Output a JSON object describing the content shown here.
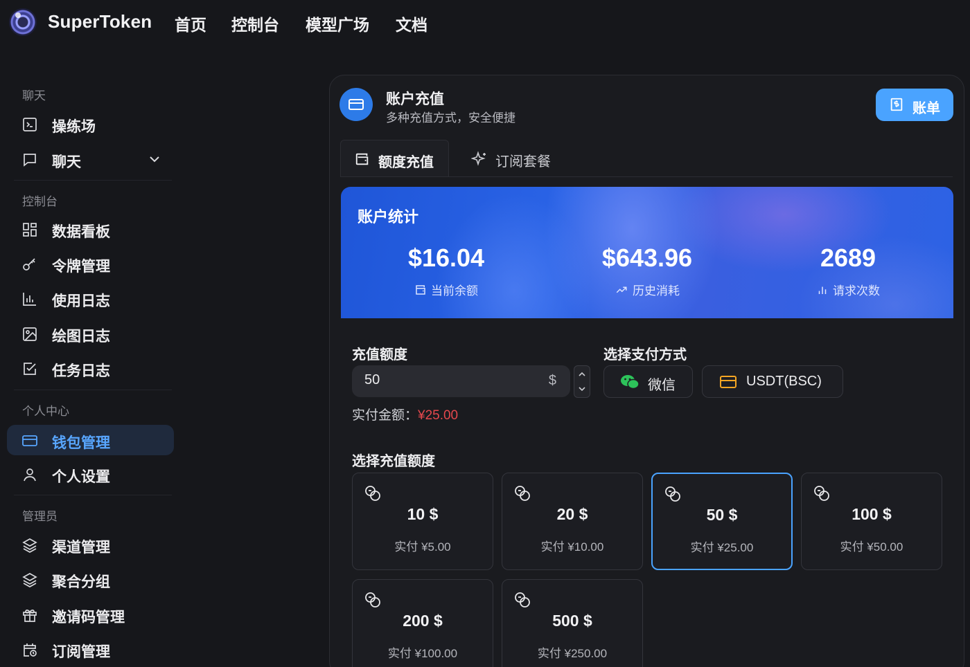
{
  "brand": "SuperToken",
  "nav": [
    "首页",
    "控制台",
    "模型广场",
    "文档"
  ],
  "sidebar": {
    "sections": [
      {
        "title": "聊天",
        "items": [
          {
            "label": "操练场",
            "icon": "terminal-icon"
          },
          {
            "label": "聊天",
            "icon": "chat-icon"
          }
        ]
      },
      {
        "title": "控制台",
        "items": [
          {
            "label": "数据看板",
            "icon": "dashboard-icon"
          },
          {
            "label": "令牌管理",
            "icon": "key-icon"
          },
          {
            "label": "使用日志",
            "icon": "bar-chart-icon"
          },
          {
            "label": "绘图日志",
            "icon": "image-icon"
          },
          {
            "label": "任务日志",
            "icon": "checkbox-icon"
          }
        ]
      },
      {
        "title": "个人中心",
        "items": [
          {
            "label": "钱包管理",
            "icon": "wallet-card-icon",
            "active": true
          },
          {
            "label": "个人设置",
            "icon": "user-icon"
          }
        ]
      },
      {
        "title": "管理员",
        "items": [
          {
            "label": "渠道管理",
            "icon": "layers-icon"
          },
          {
            "label": "聚合分组",
            "icon": "layers-icon"
          },
          {
            "label": "邀请码管理",
            "icon": "gift-icon"
          },
          {
            "label": "订阅管理",
            "icon": "calendar-clock-icon"
          }
        ]
      }
    ]
  },
  "header": {
    "title": "账户充值",
    "subtitle": "多种充值方式，安全便捷",
    "bill_button": "账单"
  },
  "tabs": [
    "额度充值",
    "订阅套餐"
  ],
  "stats": {
    "title": "账户统计",
    "items": [
      {
        "value": "$16.04",
        "label": "当前余额",
        "icon": "wallet-icon"
      },
      {
        "value": "$643.96",
        "label": "历史消耗",
        "icon": "trend-up-icon"
      },
      {
        "value": "2689",
        "label": "请求次数",
        "icon": "bar-chart-icon"
      }
    ]
  },
  "form": {
    "amount_label": "充值额度",
    "amount_value": "50",
    "currency": "$",
    "paid_label": "实付金额：",
    "paid_value": "¥25.00",
    "payment_label": "选择支付方式",
    "payment_methods": [
      "微信",
      "USDT(BSC)"
    ],
    "preset_label": "选择充值额度"
  },
  "presets": [
    {
      "value": "10 $",
      "paid": "实付 ¥5.00"
    },
    {
      "value": "20 $",
      "paid": "实付 ¥10.00"
    },
    {
      "value": "50 $",
      "paid": "实付 ¥25.00",
      "selected": true
    },
    {
      "value": "100 $",
      "paid": "实付 ¥50.00"
    },
    {
      "value": "200 $",
      "paid": "实付 ¥100.00"
    },
    {
      "value": "500 $",
      "paid": "实付 ¥250.00"
    }
  ],
  "colors": {
    "accent": "#4aa3ff",
    "banner": "#2a63e6",
    "price": "#e5484d",
    "wechat": "#2dc35a"
  }
}
